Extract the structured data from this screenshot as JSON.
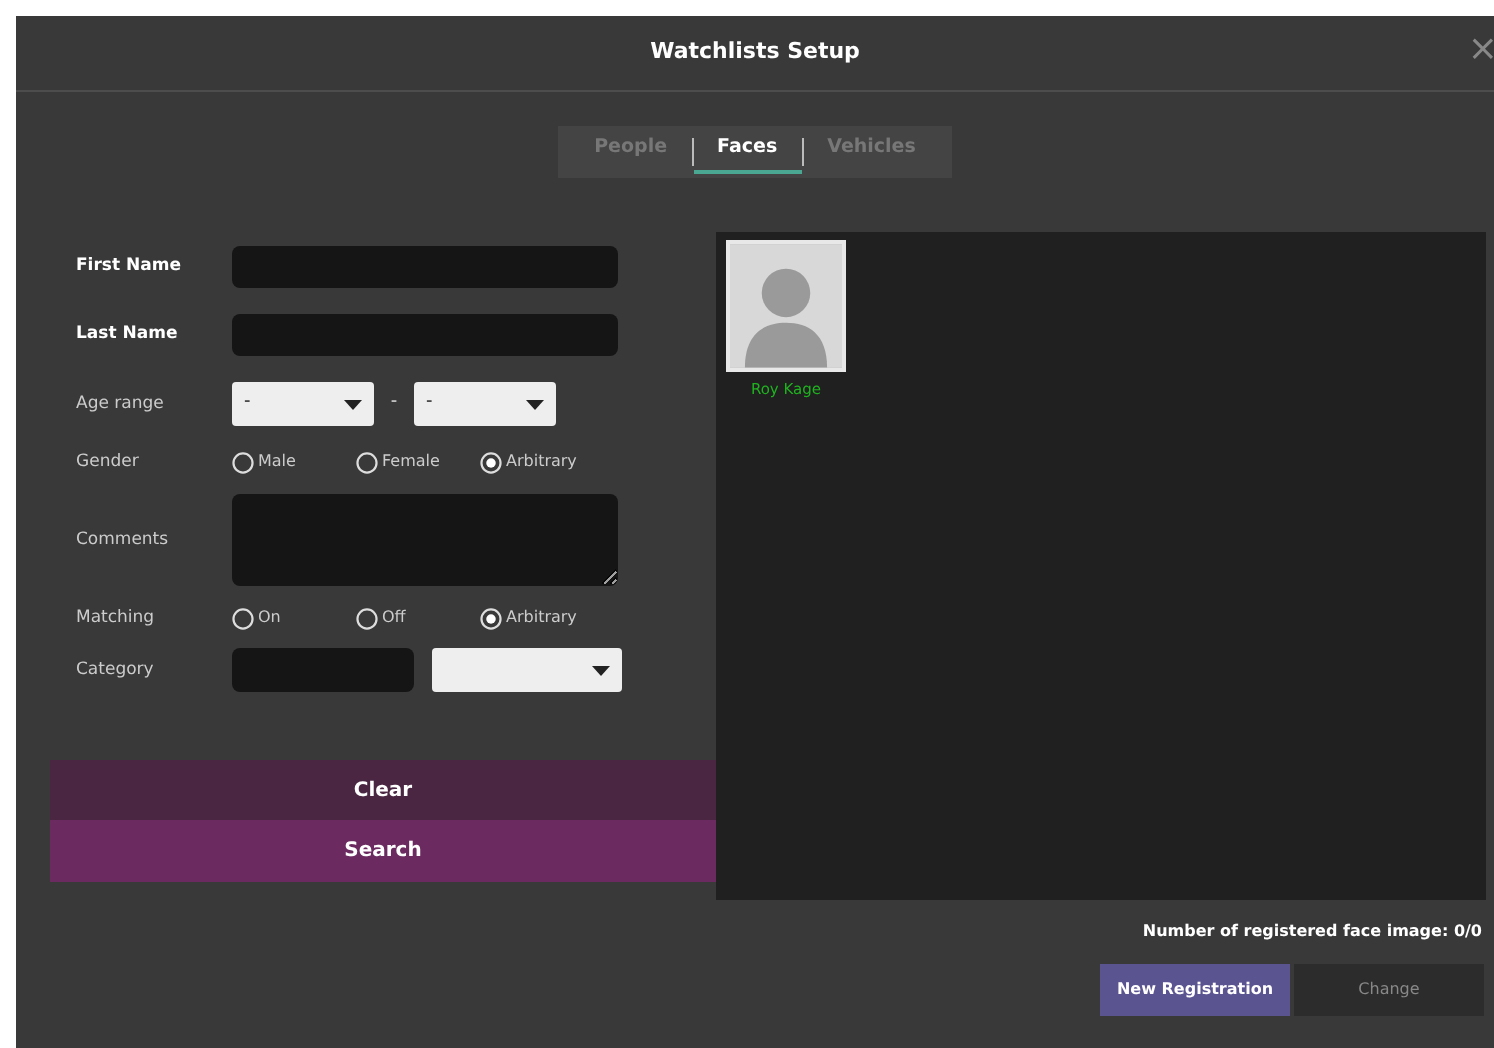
{
  "window": {
    "title": "Watchlists Setup",
    "close": "×"
  },
  "tabs": [
    {
      "label": "People",
      "selected": false
    },
    {
      "label": "Faces",
      "selected": true
    },
    {
      "label": "Vehicles",
      "selected": false
    }
  ],
  "form": {
    "rows": [
      {
        "kind": "text",
        "label": "First Name"
      },
      {
        "kind": "text",
        "label": "Last Name"
      },
      {
        "kind": "range",
        "label": "Age range",
        "from": "-",
        "separator": "-",
        "to": "-"
      },
      {
        "kind": "radio",
        "label": "Gender",
        "options": [
          {
            "label": "Male",
            "selected": false
          },
          {
            "label": "Female",
            "selected": false
          },
          {
            "label": "Arbitrary",
            "selected": true
          }
        ]
      },
      {
        "kind": "textarea",
        "label": "Comments"
      },
      {
        "kind": "radio",
        "label": "Matching",
        "options": [
          {
            "label": "On",
            "selected": false
          },
          {
            "label": "Off",
            "selected": false
          },
          {
            "label": "Arbitrary",
            "selected": true
          }
        ]
      },
      {
        "kind": "category",
        "label": "Category"
      }
    ]
  },
  "buttons": {
    "clear": "Clear",
    "search": "Search"
  },
  "results": [
    {
      "name": "Roy Kage"
    }
  ],
  "count_text": "Number of registered face image: 0/0",
  "actions": [
    {
      "label": "New Registration",
      "disabled": false
    },
    {
      "label": "Change",
      "disabled": true
    }
  ]
}
